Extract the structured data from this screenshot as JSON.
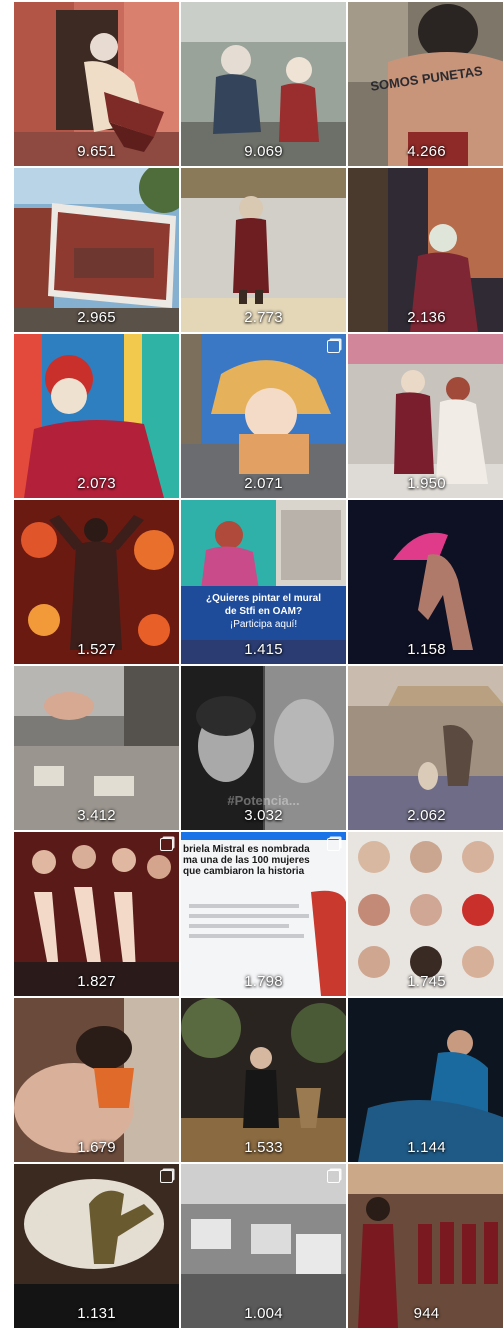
{
  "posts": [
    {
      "count": "9.651"
    },
    {
      "count": "9.069"
    },
    {
      "count": "4.266",
      "back_text": "SOMOS PUNETAS"
    },
    {
      "count": "2.965"
    },
    {
      "count": "2.773"
    },
    {
      "count": "2.136"
    },
    {
      "count": "2.073"
    },
    {
      "count": "2.071"
    },
    {
      "count": "1.950"
    },
    {
      "count": "1.527"
    },
    {
      "count": "1.415",
      "overlay_line1": "¿Quieres pintar el mural",
      "overlay_line2": "de Stfi en OAM?",
      "overlay_line3": "¡Participa aquí!"
    },
    {
      "count": "1.158"
    },
    {
      "count": "3.412"
    },
    {
      "count": "3.032",
      "watermark": "#Potencia..."
    },
    {
      "count": "2.062"
    },
    {
      "count": "1.827"
    },
    {
      "count": "1.798",
      "article_text": "briela Mistral es nombrada ma una de las 100 mujeres que cambiaron la historia"
    },
    {
      "count": "1.745"
    },
    {
      "count": "1.679"
    },
    {
      "count": "1.533"
    },
    {
      "count": "1.144"
    },
    {
      "count": "1.131"
    },
    {
      "count": "1.004"
    },
    {
      "count": "944"
    }
  ]
}
